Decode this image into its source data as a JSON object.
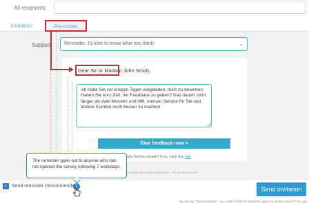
{
  "recipients": {
    "label": "All recipients:",
    "value": ""
  },
  "tabs": [
    {
      "label": "Invitation",
      "active": false
    },
    {
      "label": "Reminder",
      "active": true
    }
  ],
  "subject": {
    "label": "Subject",
    "value": "Reminder: I'd love to know what you think!"
  },
  "email": {
    "greeting_salutation": "Dear Sir or Madam",
    "greeting_name": "John Smith,",
    "body": "ich habe Sie vor einigen Tagen eingeladen, mich zu bewerten. Haben Sie kurz Zeit, mir Feedback zu geben? Das dauert nicht länger als zwei Minuten und hilft, meinen Service für Sie und andere Kunden noch besser zu machen.",
    "cta_label": "Give feedback now >",
    "unsubscribe_text": "ave further emails? If so, click this ",
    "unsubscribe_link": "link",
    "powered_by": "nrerature by ProvenExpert.com - It's All About Trust"
  },
  "tooltip": {
    "text": "The reminder goes out to anyone who has not opened the survey following 7 workdays."
  },
  "footer": {
    "send_reminder_label": "Send reminder (recommended)",
    "send_reminder_checked": true,
    "send_button_label": "Send invitation",
    "disclaimer": "By clicking \"Send invitation\", you confirm that the recipients agree to receive emails from you."
  },
  "colors": {
    "accent": "#2d9bd1",
    "highlight": "#b5343a",
    "cta": "#33aacc"
  }
}
